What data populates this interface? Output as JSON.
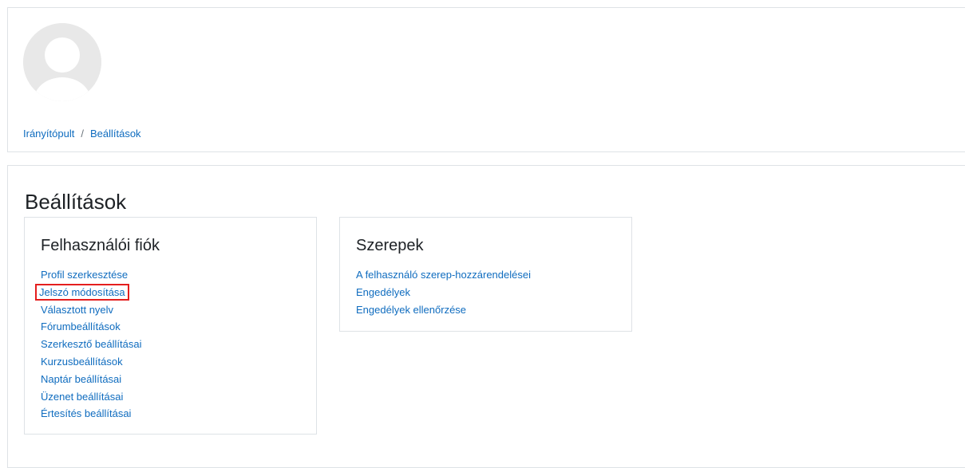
{
  "breadcrumb": {
    "items": [
      "Irányítópult",
      "Beállítások"
    ],
    "separator": "/"
  },
  "page": {
    "title": "Beállítások"
  },
  "sections": {
    "account": {
      "title": "Felhasználói fiók",
      "links": [
        "Profil szerkesztése",
        "Jelszó módosítása",
        "Választott nyelv",
        "Fórumbeállítások",
        "Szerkesztő beállításai",
        "Kurzusbeállítások",
        "Naptár beállításai",
        "Üzenet beállításai",
        "Értesítés beállításai"
      ]
    },
    "roles": {
      "title": "Szerepek",
      "links": [
        "A felhasználó szerep-hozzárendelései",
        "Engedélyek",
        "Engedélyek ellenőrzése"
      ]
    }
  },
  "icons": {
    "avatar": "user-avatar-placeholder-icon"
  },
  "colors": {
    "link": "#0f6cbf",
    "highlight": "#e41e1e",
    "border": "#dee2e6",
    "avatar_bg": "#e8e8e8"
  }
}
